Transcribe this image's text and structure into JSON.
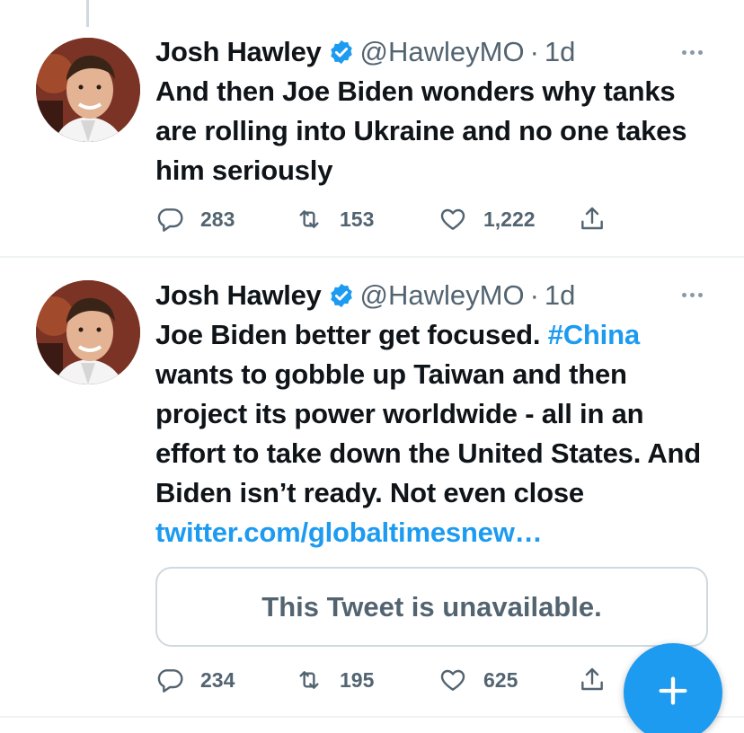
{
  "colors": {
    "accent": "#1d9bf0",
    "secondary_text": "#536471",
    "border": "#cfd9de"
  },
  "tweets": [
    {
      "author_name": "Josh Hawley",
      "handle": "@HawleyMO",
      "separator": "·",
      "time": "1d",
      "verified_icon": "verified-badge-icon",
      "text": "And then Joe Biden wonders why tanks are rolling into Ukraine and no one takes him seriously",
      "reply_count": "283",
      "retweet_count": "153",
      "like_count": "1,222"
    },
    {
      "author_name": "Josh Hawley",
      "handle": "@HawleyMO",
      "separator": "·",
      "time": "1d",
      "verified_icon": "verified-badge-icon",
      "text_before_hashtag": "Joe Biden better get focused. ",
      "hashtag": "#China",
      "text_after_hashtag": " wants to gobble up Taiwan and then project its power worldwide - all in an effort to take down the United States. And Biden isn’t ready. Not even close",
      "link": "twitter.com/globaltimesnew…",
      "quoted_tweet_text": "This Tweet is unavailable.",
      "reply_count": "234",
      "retweet_count": "195",
      "like_count": "625"
    }
  ],
  "icons": {
    "reply": "reply-icon",
    "retweet": "retweet-icon",
    "like": "heart-icon",
    "share": "share-icon",
    "more": "more-icon",
    "compose": "plus-icon"
  }
}
